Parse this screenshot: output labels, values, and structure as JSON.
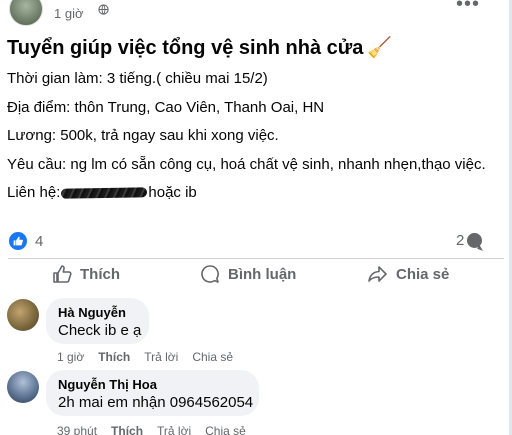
{
  "post": {
    "time": "1 giờ",
    "privacy_icon": "globe-icon",
    "title": "Tuyển giúp việc tổng vệ sinh nhà cửa",
    "title_emoji": "🧹",
    "lines": {
      "time": "Thời gian làm: 3 tiếng.( chiều mai 15/2)",
      "location": "Địa điểm: thôn Trung, Cao Viên, Thanh Oai, HN",
      "salary": "Lương: 500k, trả ngay sau khi xong việc.",
      "requirement": "Yêu cầu: ng lm có sẵn công cụ, hoá chất vệ sinh, nhanh nhẹn,thạo việc.",
      "contact_label": "Liên hệ:",
      "contact_suffix": "hoặc ib"
    },
    "reaction_count": "4",
    "comment_count": "2"
  },
  "actions": {
    "like": "Thích",
    "comment": "Bình luận",
    "share": "Chia sẻ"
  },
  "comments": [
    {
      "author": "Hà Nguyễn",
      "text": "Check ib e ạ",
      "time": "1 giờ",
      "like": "Thích",
      "reply": "Trả lời",
      "share": "Chia sẻ"
    },
    {
      "author": "Nguyễn Thị Hoa",
      "text": "2h mai em nhận 0964562054",
      "time": "39 phút",
      "like": "Thích",
      "reply": "Trả lời",
      "share": "Chia sẻ"
    }
  ],
  "colors": {
    "brand_blue": "#1877f2",
    "secondary_text": "#65676b",
    "bubble_bg": "#f0f2f5"
  }
}
